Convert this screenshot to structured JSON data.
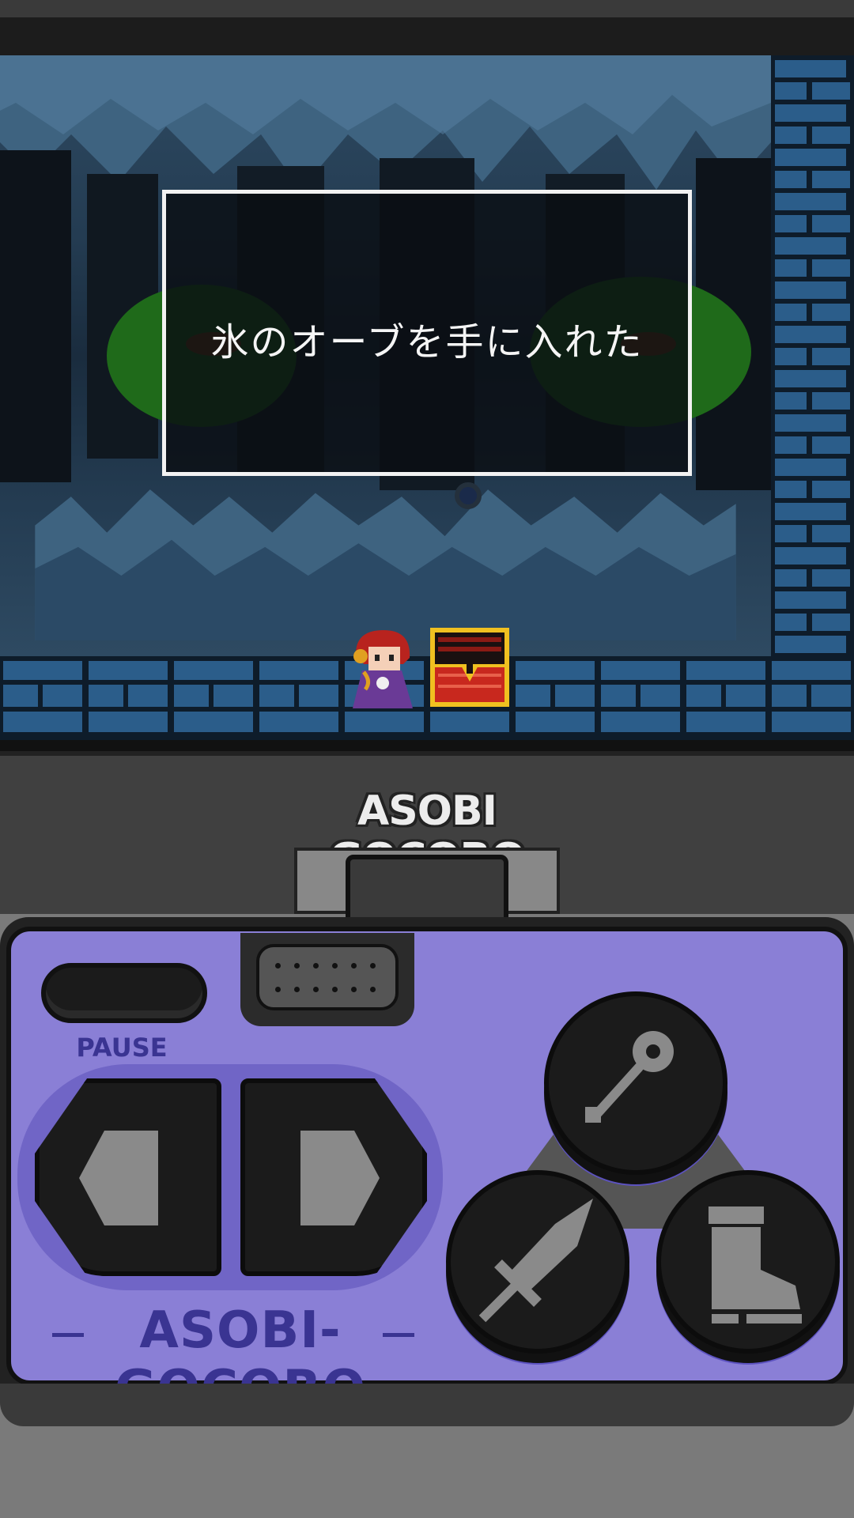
{
  "dialog": {
    "message": "氷のオーブを手に入れた"
  },
  "console": {
    "brand_top": "ASOBI GOCORO",
    "brand_bottom": "ASOBI-GOCORO",
    "pause_label": "PAUSE"
  },
  "controls": {
    "dpad": [
      "left-arrow-icon",
      "right-arrow-icon"
    ],
    "actions": [
      "magic-wand-icon",
      "sword-icon",
      "boot-icon"
    ],
    "triangles": [
      "triangle-left-icon",
      "triangle-right-icon"
    ]
  },
  "colors": {
    "screen_bg": "#243c52",
    "brick_blue": "#2b5d8a",
    "pad_purple": "#8a7fd6",
    "brand_purple": "#3a3492"
  }
}
